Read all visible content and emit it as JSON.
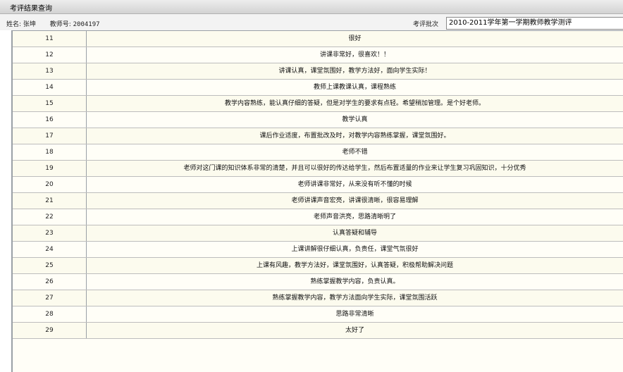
{
  "window": {
    "title": "考评结果查询"
  },
  "info": {
    "name_label": "姓名:",
    "name_value": "张坤",
    "teacher_no_label": "教师号:",
    "teacher_no_value": "2004197",
    "batch_label": "考评批次",
    "batch_value": "2010-2011学年第一学期教师教学测评"
  },
  "rows": [
    {
      "no": "11",
      "comment": "很好"
    },
    {
      "no": "12",
      "comment": "讲课非常好，很喜欢！！"
    },
    {
      "no": "13",
      "comment": "讲课认真，课堂氛围好，教学方法好，面向学生实际！"
    },
    {
      "no": "14",
      "comment": "教师上课教课认真，课程熟练"
    },
    {
      "no": "15",
      "comment": "教学内容熟练，能认真仔细的答疑，但是对学生的要求有点轻。希望稍加管理。是个好老师。"
    },
    {
      "no": "16",
      "comment": "教学认真"
    },
    {
      "no": "17",
      "comment": "课后作业适度，布置批改及时，对教学内容熟练掌握，课堂氛围好。"
    },
    {
      "no": "18",
      "comment": "老师不错"
    },
    {
      "no": "19",
      "comment": "老师对这门课的知识体系非常的清楚，并且可以很好的传达给学生，然后布置适量的作业来让学生复习巩固知识，十分优秀"
    },
    {
      "no": "20",
      "comment": "老师讲课非常好，从来没有听不懂的时候"
    },
    {
      "no": "21",
      "comment": "老师讲课声音宏亮，讲课很清晰，很容易理解"
    },
    {
      "no": "22",
      "comment": "老师声音洪亮，思路清晰明了"
    },
    {
      "no": "23",
      "comment": "认真答疑和辅导"
    },
    {
      "no": "24",
      "comment": "上课讲解很仔细认真，负责任，课堂气氛很好"
    },
    {
      "no": "25",
      "comment": "上课有风趣，教学方法好，课堂氛围好，认真答疑，积极帮助解决问题"
    },
    {
      "no": "26",
      "comment": "熟练掌握教学内容，负责认真。"
    },
    {
      "no": "27",
      "comment": "熟练掌握教学内容，教学方法面向学生实际，课堂氛围活跃"
    },
    {
      "no": "28",
      "comment": "思路非常清晰"
    },
    {
      "no": "29",
      "comment": "太好了"
    }
  ]
}
